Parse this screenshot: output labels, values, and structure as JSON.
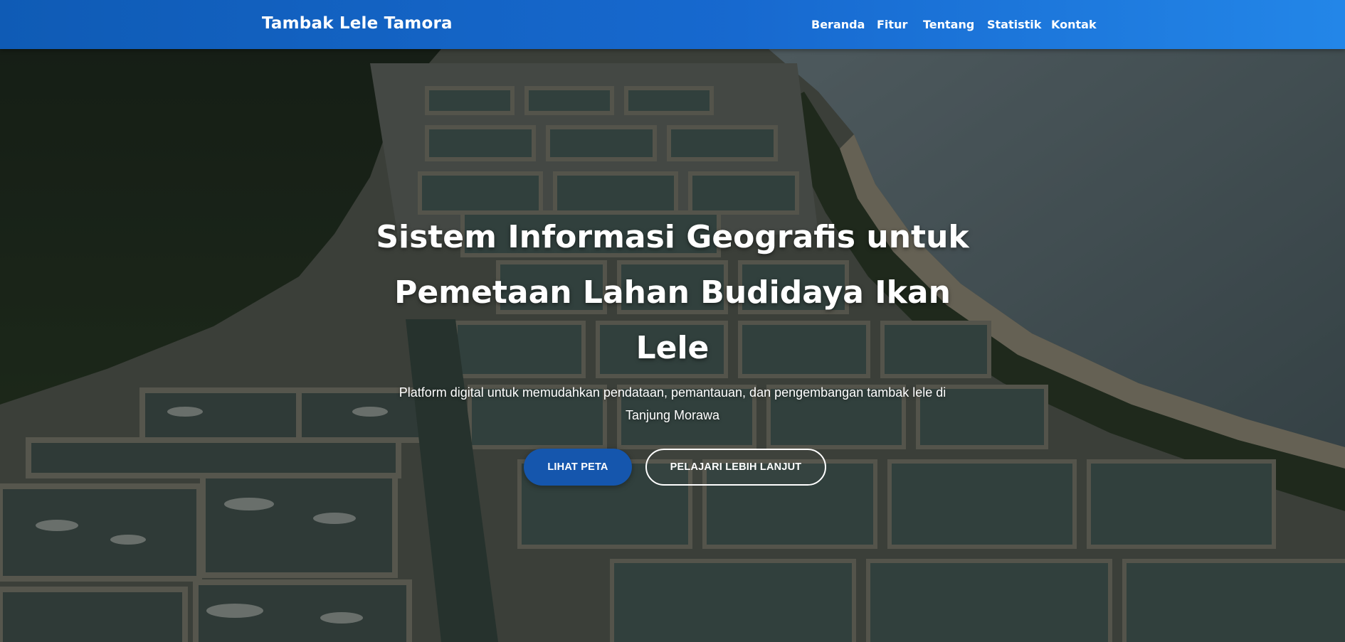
{
  "navbar": {
    "brand": "Tambak Lele Tamora",
    "links": [
      "Beranda",
      "Fitur",
      "Tentang",
      "Statistik",
      "Kontak"
    ]
  },
  "hero": {
    "title": "Sistem Informasi Geografis untuk Pemetaan Lahan Budidaya Ikan Lele",
    "subtitle": "Platform digital untuk memudahkan pendataan, pemantauan, dan pengembangan tambak lele di Tanjung Morawa",
    "primary_button": "LIHAT PETA",
    "secondary_button": "PELAJARI LEBIH LANJUT"
  },
  "colors": {
    "navbar_start": "#0f5bb5",
    "navbar_end": "#2386e8",
    "primary_button": "#1556ad"
  }
}
